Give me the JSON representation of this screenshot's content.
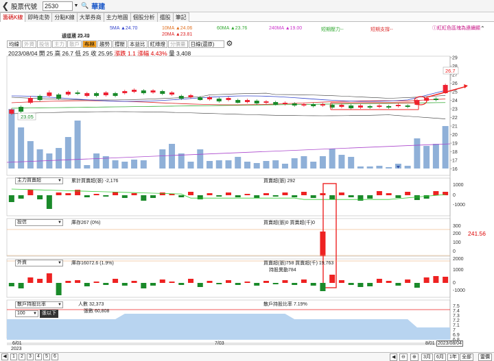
{
  "topbar": {
    "back_glyph": "❮",
    "title": "股票代號",
    "code": "2530",
    "name": "華建"
  },
  "tabs": [
    "籌碼K線",
    "即時走勢",
    "分點K線",
    "大單券商",
    "主力地圖",
    "個股分析",
    "擂股",
    "筆記"
  ],
  "ma_legend": {
    "ma5": "5MA ▲24.70",
    "ma10": "10MA ▲24.06",
    "ma60": "60MA ▲23.76",
    "ma240": "240MA ▲19.00",
    "short_pressure": "短期壓力--",
    "short_support": "短期支撐--",
    "upper": "通道頂 25.20",
    "lower": "通道底 22.43",
    "ma20": "20MA ▲23.81",
    "action": "紅紅色區塊為連續顯",
    "colors": {
      "ma5": "#3344cc",
      "ma10": "#e07020",
      "ma60": "#33aa33",
      "ma240": "#cc33cc",
      "ma20": "#dd2222",
      "pressure": "#33aa33",
      "support": "#dd3333"
    }
  },
  "toolbar": {
    "items": [
      "均線",
      "外資",
      "投信",
      "主力",
      "散戶",
      "布林",
      "趨勢",
      "撐壓",
      "本益比",
      "紅綠燈",
      "分價量"
    ],
    "period": "日線(還原)"
  },
  "ohlc": {
    "date": "2023/08/04",
    "open": "開 25",
    "high": "高 26.7",
    "low": "低 25",
    "close": "收 25.95",
    "chg_label": "漲跌",
    "chg": "1.1",
    "pct_label": "漲幅",
    "pct": "4.43%",
    "vol_label": "量",
    "vol": "3,408"
  },
  "price_axis": [
    "29",
    "28",
    "27",
    "26",
    "25",
    "24",
    "23",
    "22",
    "21",
    "20",
    "19",
    "18",
    "17",
    "16"
  ],
  "price_labels": {
    "high": "26.7",
    "low": "23.05"
  },
  "panels": {
    "main_force": {
      "select": "主力買賣超",
      "cum": "累計買賣超(張) -2,176",
      "daily": "買賣超(張) 292",
      "axis": [
        "1000",
        "0",
        "-1000"
      ]
    },
    "trust": {
      "select": "投信",
      "stock": "庫存267 (0%)",
      "daily": "買賣超(張)0 買賣超(千)0",
      "axis": [
        "300",
        "200",
        "100",
        "0"
      ],
      "price": "241.56"
    },
    "foreign": {
      "select": "外資",
      "stock": "庫存16072.6 (1.9%)",
      "daily": "買賣超(張)758 買賣超(千) 19,763",
      "change": "持股異動784",
      "axis": [
        "2000",
        "1000",
        "0",
        "-1000"
      ]
    },
    "retail": {
      "select": "散戶持股比率",
      "people": "人數 32,373",
      "shares": "張數 60,808",
      "ratio": "散戶持股比率 7.19%",
      "axis": [
        "7.5",
        "7.4",
        "7.3",
        "7.2",
        "7.1",
        "7",
        "6.9",
        "6.8"
      ],
      "level": "100",
      "level_btn": "張以下"
    }
  },
  "dates": {
    "d1": "6/01",
    "y1": "2023",
    "d2": "7/03",
    "d3": "8/01",
    "cur": "2023/08/04"
  },
  "bottom": {
    "pages": [
      "1",
      "2",
      "3",
      "4",
      "5",
      "6"
    ],
    "prev": "◀",
    "right": [
      "◀",
      "⊖",
      "⊕",
      "3月",
      "6月",
      "1年",
      "全部",
      "靈價"
    ]
  }
}
